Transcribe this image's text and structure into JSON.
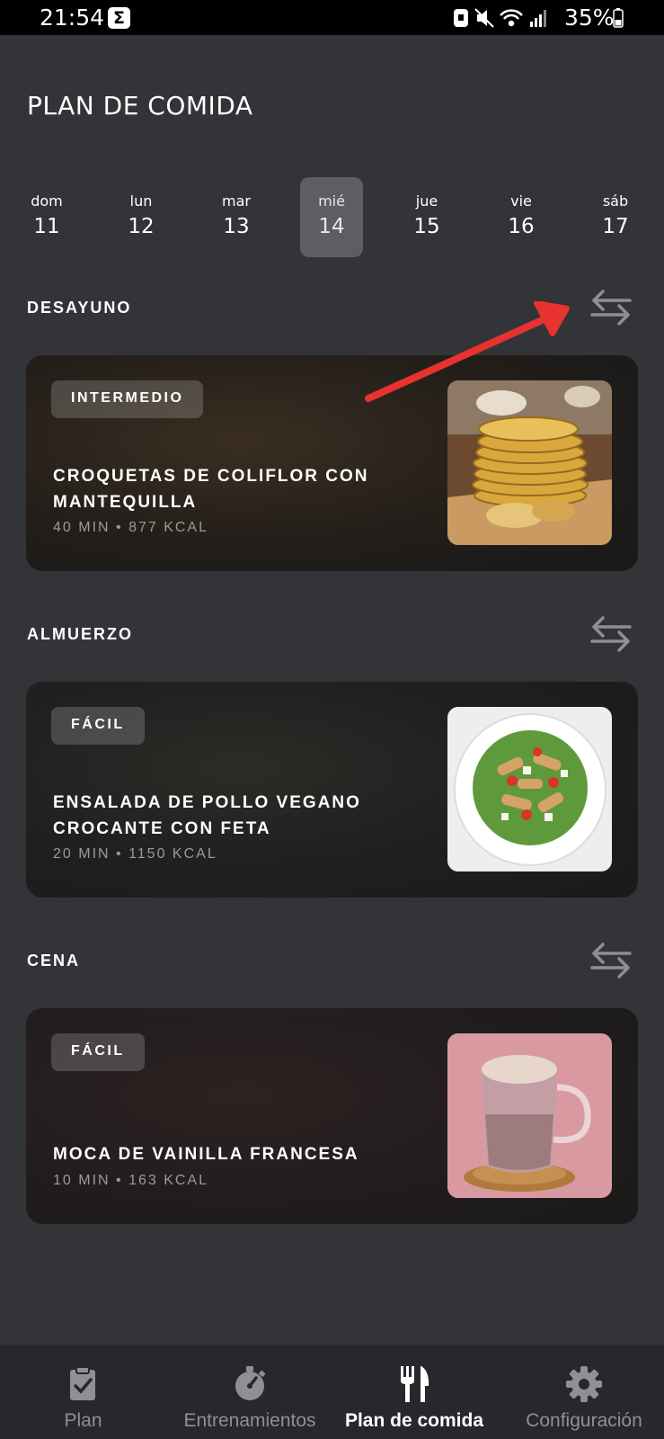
{
  "status_bar": {
    "time": "21:54",
    "app_glyph": "Σ",
    "battery": "35%"
  },
  "page_title": "PLAN DE COMIDA",
  "days": [
    {
      "name": "dom",
      "num": "11"
    },
    {
      "name": "lun",
      "num": "12"
    },
    {
      "name": "mar",
      "num": "13"
    },
    {
      "name": "mié",
      "num": "14",
      "selected": true
    },
    {
      "name": "jue",
      "num": "15"
    },
    {
      "name": "vie",
      "num": "16"
    },
    {
      "name": "sáb",
      "num": "17"
    }
  ],
  "meals": [
    {
      "section": "DESAYUNO",
      "badge": "INTERMEDIO",
      "title": "CROQUETAS DE COLIFLOR CON MANTEQUILLA",
      "meta": "40 MIN • 877 KCAL",
      "image_icon": "cauliflower-croquettes-photo"
    },
    {
      "section": "ALMUERZO",
      "badge": "FÁCIL",
      "title": "ENSALADA DE POLLO VEGANO CROCANTE CON FETA",
      "meta": "20 MIN • 1150 KCAL",
      "image_icon": "chicken-salad-photo"
    },
    {
      "section": "CENA",
      "badge": "FÁCIL",
      "title": "MOCA DE VAINILLA FRANCESA",
      "meta": "10 MIN • 163 KCAL",
      "image_icon": "vanilla-mocha-photo"
    }
  ],
  "nav": [
    {
      "label": "Plan",
      "icon": "clipboard-icon"
    },
    {
      "label": "Entrenamientos",
      "icon": "stopwatch-icon"
    },
    {
      "label": "Plan de comida",
      "icon": "fork-knife-icon",
      "active": true
    },
    {
      "label": "Configuración",
      "icon": "gear-icon"
    }
  ],
  "colors": {
    "background": "#333438",
    "selected_day": "#5d5e62",
    "nav_background": "#27282b",
    "annotation_arrow": "#e8322f"
  }
}
